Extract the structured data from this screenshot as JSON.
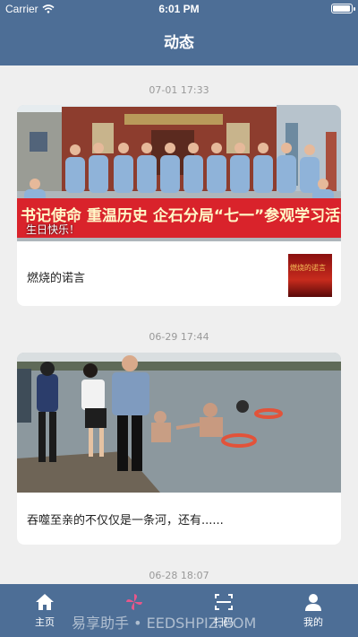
{
  "status_bar": {
    "carrier": "Carrier",
    "time": "6:01 PM"
  },
  "header": {
    "title": "动态"
  },
  "feed": [
    {
      "timestamp": "07-01 17:33",
      "caption": "燃烧的诺言",
      "banner_text": "书记使命 重温历史 企石分局“七一”参观学习活动",
      "overlay_text": "生日快乐！",
      "thumb_text": "燃烧的诺言"
    },
    {
      "timestamp": "06-29 17:44",
      "caption": "吞噬至亲的不仅仅是一条河，还有......"
    },
    {
      "timestamp": "06-28 18:07"
    }
  ],
  "tabbar": {
    "items": [
      {
        "label": "主页",
        "icon": "home-icon"
      },
      {
        "label": "",
        "icon": "pinwheel-icon"
      },
      {
        "label": "扫码",
        "icon": "scan-icon"
      },
      {
        "label": "我的",
        "icon": "user-icon"
      }
    ]
  },
  "watermark": "易享助手 • EEDSHPIZ.COM"
}
